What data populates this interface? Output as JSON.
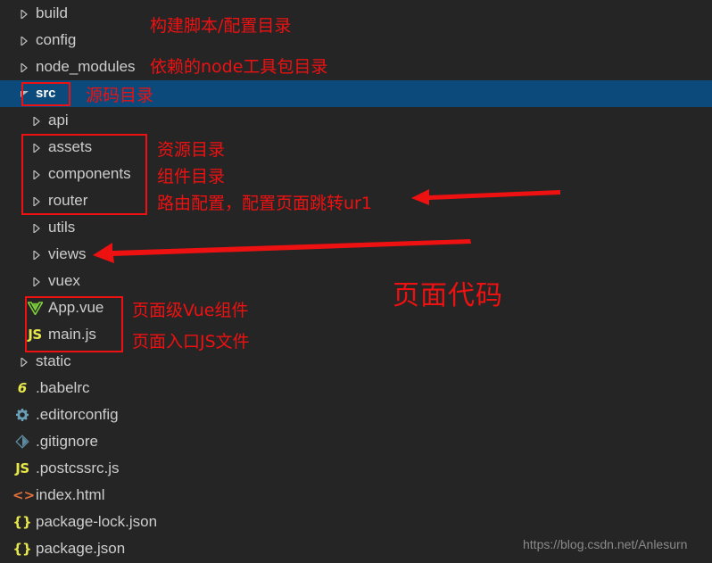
{
  "window": {
    "background_color": "#252526",
    "selection_color": "#0b4a7a",
    "text_color": "#cdcdcd",
    "annotation_color": "#ee1111"
  },
  "explorer": {
    "rows": [
      {
        "name": "build",
        "kind": "folder",
        "depth": 1,
        "expanded": false,
        "icon": "chevron-right-icon",
        "selected": false
      },
      {
        "name": "config",
        "kind": "folder",
        "depth": 1,
        "expanded": false,
        "icon": "chevron-right-icon",
        "selected": false
      },
      {
        "name": "node_modules",
        "kind": "folder",
        "depth": 1,
        "expanded": false,
        "icon": "chevron-right-icon",
        "selected": false
      },
      {
        "name": "src",
        "kind": "folder",
        "depth": 1,
        "expanded": true,
        "icon": "chevron-down-icon",
        "selected": true
      },
      {
        "name": "api",
        "kind": "folder",
        "depth": 2,
        "expanded": false,
        "icon": "chevron-right-icon",
        "selected": false
      },
      {
        "name": "assets",
        "kind": "folder",
        "depth": 2,
        "expanded": false,
        "icon": "chevron-right-icon",
        "selected": false
      },
      {
        "name": "components",
        "kind": "folder",
        "depth": 2,
        "expanded": false,
        "icon": "chevron-right-icon",
        "selected": false
      },
      {
        "name": "router",
        "kind": "folder",
        "depth": 2,
        "expanded": false,
        "icon": "chevron-right-icon",
        "selected": false
      },
      {
        "name": "utils",
        "kind": "folder",
        "depth": 2,
        "expanded": false,
        "icon": "chevron-right-icon",
        "selected": false
      },
      {
        "name": "views",
        "kind": "folder",
        "depth": 2,
        "expanded": false,
        "icon": "chevron-right-icon",
        "selected": false
      },
      {
        "name": "vuex",
        "kind": "folder",
        "depth": 2,
        "expanded": false,
        "icon": "chevron-right-icon",
        "selected": false
      },
      {
        "name": "App.vue",
        "kind": "file",
        "depth": 2,
        "icon": "vue-file-icon",
        "glyph": "V",
        "icon_class": "ic-vue"
      },
      {
        "name": "main.js",
        "kind": "file",
        "depth": 2,
        "icon": "js-file-icon",
        "glyph": "JS",
        "icon_class": "ic-js"
      },
      {
        "name": "static",
        "kind": "folder",
        "depth": 1,
        "expanded": false,
        "icon": "chevron-right-icon",
        "selected": false
      },
      {
        "name": ".babelrc",
        "kind": "file",
        "depth": 1,
        "icon": "babel-file-icon",
        "glyph": "6",
        "icon_class": "ic-babel"
      },
      {
        "name": ".editorconfig",
        "kind": "file",
        "depth": 1,
        "icon": "gear-icon",
        "glyph": "",
        "icon_class": "ic-gear"
      },
      {
        "name": ".gitignore",
        "kind": "file",
        "depth": 1,
        "icon": "git-file-icon",
        "glyph": "",
        "icon_class": "ic-git"
      },
      {
        "name": ".postcssrc.js",
        "kind": "file",
        "depth": 1,
        "icon": "js-file-icon",
        "glyph": "JS",
        "icon_class": "ic-js"
      },
      {
        "name": "index.html",
        "kind": "file",
        "depth": 1,
        "icon": "html-file-icon",
        "glyph": "<>",
        "icon_class": "ic-html"
      },
      {
        "name": "package-lock.json",
        "kind": "file",
        "depth": 1,
        "icon": "json-file-icon",
        "glyph": "{}",
        "icon_class": "ic-json"
      },
      {
        "name": "package.json",
        "kind": "file",
        "depth": 1,
        "icon": "json-file-icon",
        "glyph": "{}",
        "icon_class": "ic-json"
      }
    ]
  },
  "annotations": {
    "build_config": "构建脚本/配置目录",
    "node_modules": "依赖的node工具包目录",
    "src": "源码目录",
    "assets": "资源目录",
    "components": "组件目录",
    "router": "路由配置，配置页面跳转ur1",
    "page_code": "页面代码",
    "app_vue": "页面级Vue组件",
    "main_js": "页面入口JS文件"
  },
  "watermark": {
    "text": "https://blog.csdn.net/Anlesurn"
  }
}
